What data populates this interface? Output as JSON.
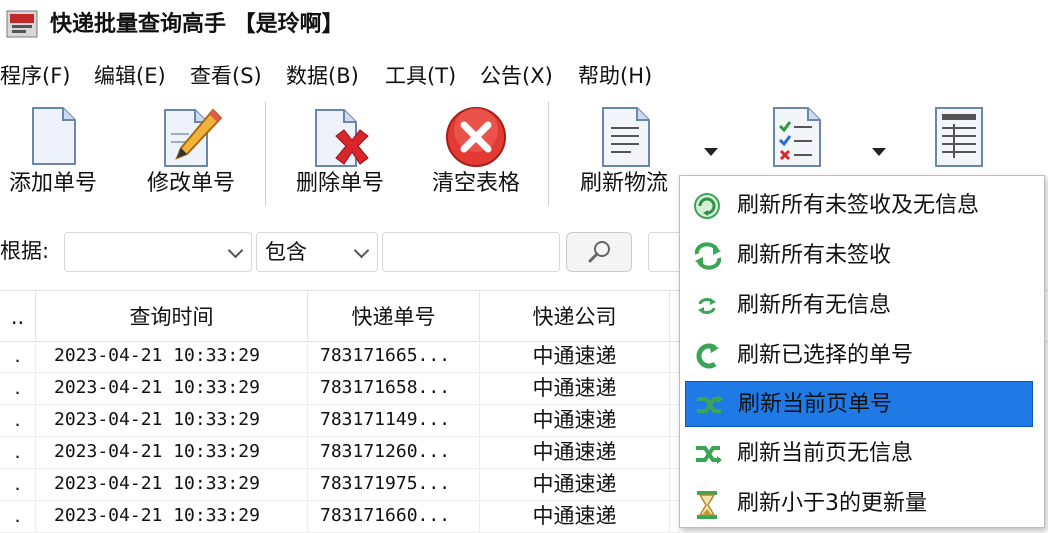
{
  "window": {
    "title": "快递批量查询高手 【是玲啊】"
  },
  "menu": {
    "items": [
      {
        "label": "程序(F)"
      },
      {
        "label": "编辑(E)"
      },
      {
        "label": "查看(S)"
      },
      {
        "label": "数据(B)"
      },
      {
        "label": "工具(T)"
      },
      {
        "label": "公告(X)"
      },
      {
        "label": "帮助(H)"
      }
    ]
  },
  "toolbar": {
    "add_label": "添加单号",
    "edit_label": "修改单号",
    "delete_label": "删除单号",
    "clear_label": "清空表格",
    "refresh_label": "刷新物流"
  },
  "filter": {
    "label": "根据:",
    "field_value": "",
    "match_value": "包含",
    "query_value": ""
  },
  "table": {
    "headers": [
      "..",
      "查询时间",
      "快递单号",
      "快递公司"
    ],
    "rows": [
      {
        "c0": ".",
        "time": "2023-04-21  10:33:29",
        "number": "783171665...",
        "company": "中通速递"
      },
      {
        "c0": ".",
        "time": "2023-04-21  10:33:29",
        "number": "783171658...",
        "company": "中通速递"
      },
      {
        "c0": ".",
        "time": "2023-04-21  10:33:29",
        "number": "783171149...",
        "company": "中通速递"
      },
      {
        "c0": ".",
        "time": "2023-04-21  10:33:29",
        "number": "783171260...",
        "company": "中通速递"
      },
      {
        "c0": ".",
        "time": "2023-04-21  10:33:29",
        "number": "783171975...",
        "company": "中通速递"
      },
      {
        "c0": ".",
        "time": "2023-04-21  10:33:29",
        "number": "783171660...",
        "company": "中通速递"
      }
    ]
  },
  "refresh_menu": {
    "items": [
      {
        "label": "刷新所有未签收及无信息",
        "icon": "refresh-globe-icon"
      },
      {
        "label": "刷新所有未签收",
        "icon": "refresh-arrows-icon"
      },
      {
        "label": "刷新所有无信息",
        "icon": "refresh-small-arrows-icon"
      },
      {
        "label": "刷新已选择的单号",
        "icon": "refresh-selected-icon"
      },
      {
        "label": "刷新当前页单号",
        "icon": "refresh-page-icon"
      },
      {
        "label": "刷新当前页无信息",
        "icon": "refresh-page-noinfo-icon"
      },
      {
        "label": "刷新小于3的更新量",
        "icon": "hourglass-icon"
      }
    ],
    "selected_index": 4
  },
  "colors": {
    "selection": "#1f7ae6",
    "icon_green": "#3aa655"
  }
}
